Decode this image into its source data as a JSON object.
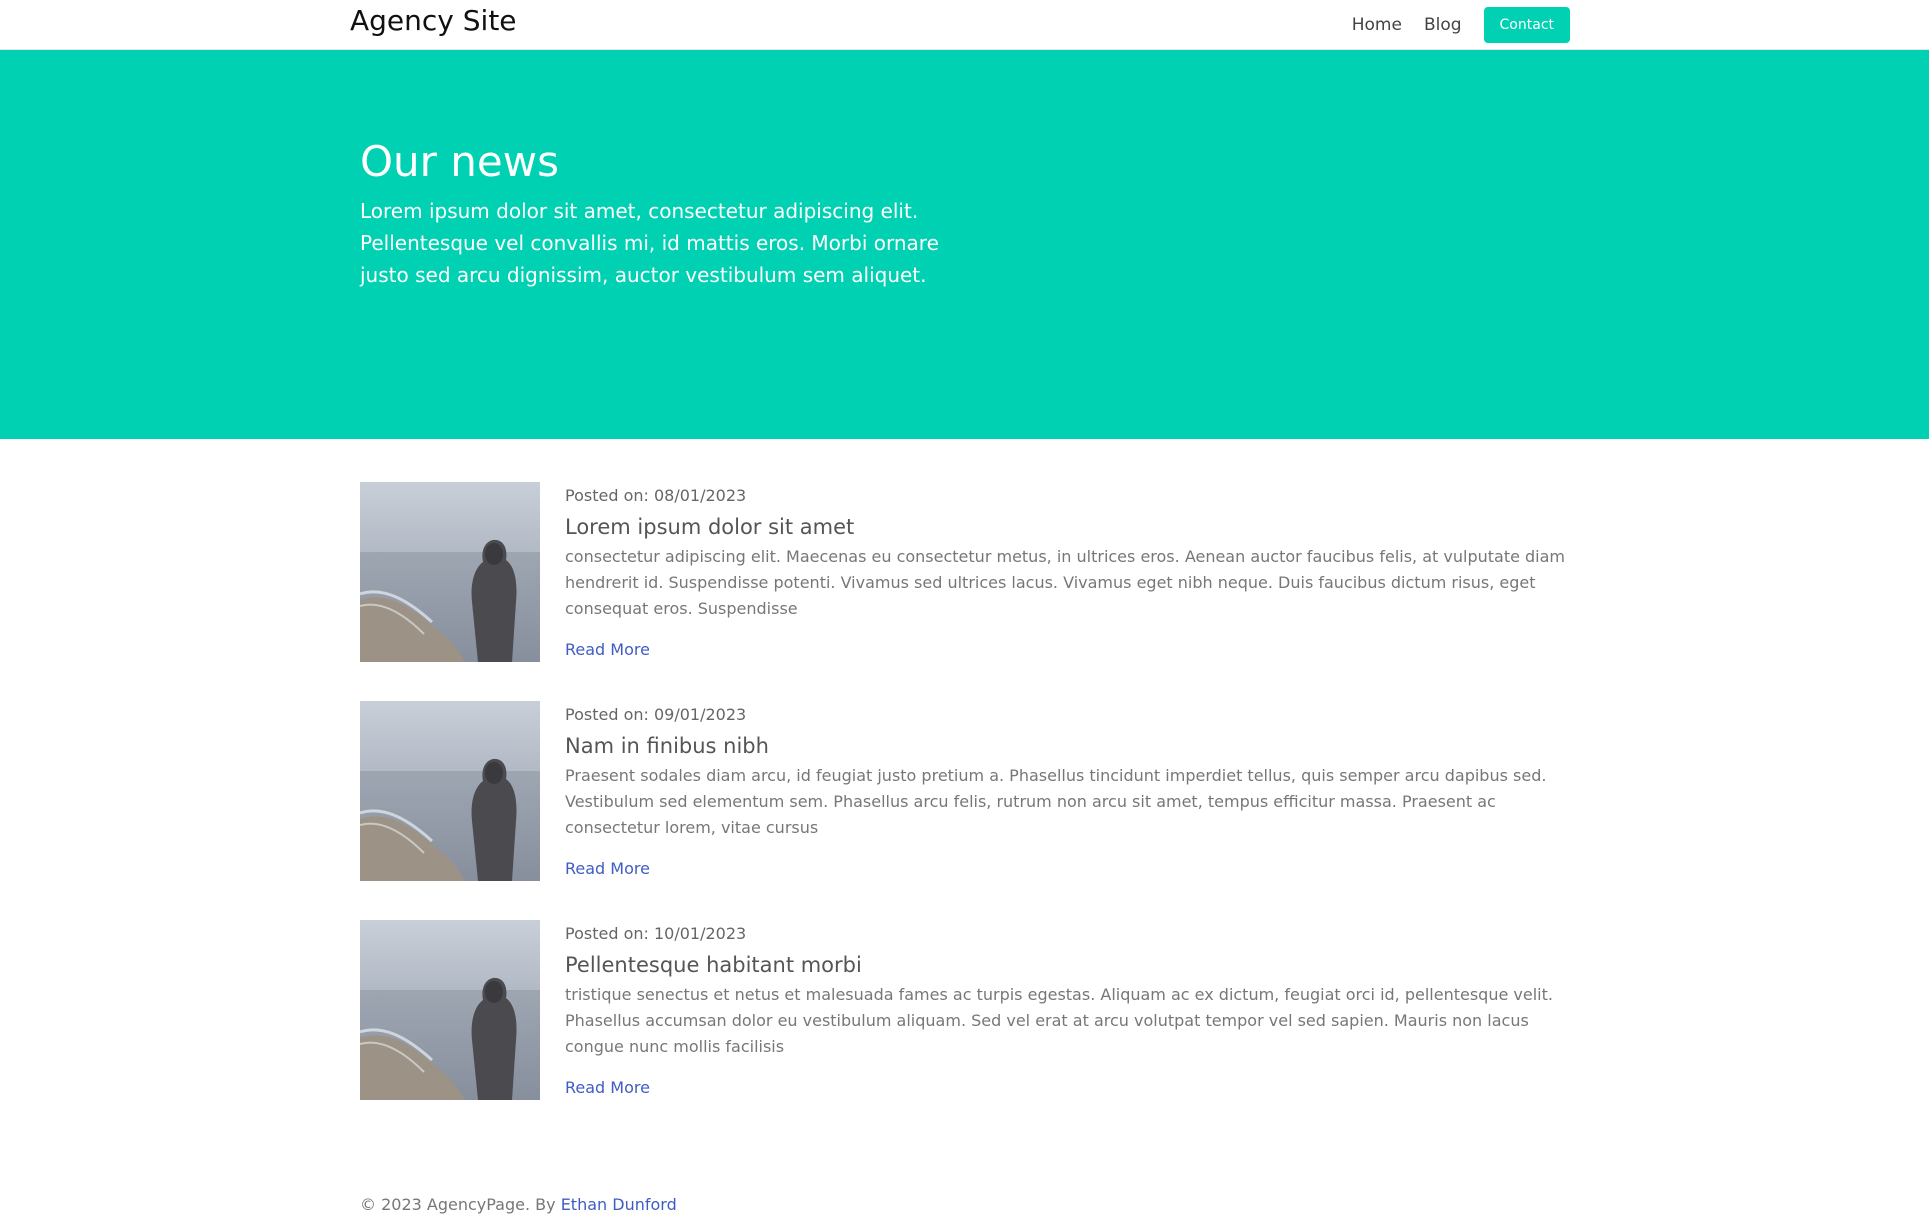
{
  "nav": {
    "brand": "Agency Site",
    "links": [
      {
        "label": "Home"
      },
      {
        "label": "Blog"
      }
    ],
    "contact_label": "Contact"
  },
  "hero": {
    "title": "Our news",
    "subtitle": "Lorem ipsum dolor sit amet, consectetur adipiscing elit. Pellentesque vel convallis mi, id mattis eros. Morbi ornare justo sed arcu dignissim, auctor vestibulum sem aliquet."
  },
  "posts": [
    {
      "date": "Posted on: 08/01/2023",
      "title": "Lorem ipsum dolor sit amet",
      "excerpt": "consectetur adipiscing elit. Maecenas eu consectetur metus, in ultrices eros. Aenean auctor faucibus felis, at vulputate diam hendrerit id. Suspendisse potenti. Vivamus sed ultrices lacus. Vivamus eget nibh neque. Duis faucibus dictum risus, eget consequat eros. Suspendisse",
      "link": "Read More"
    },
    {
      "date": "Posted on: 09/01/2023",
      "title": "Nam in finibus nibh",
      "excerpt": "Praesent sodales diam arcu, id feugiat justo pretium a. Phasellus tincidunt imperdiet tellus, quis semper arcu dapibus sed. Vestibulum sed elementum sem. Phasellus arcu felis, rutrum non arcu sit amet, tempus efficitur massa. Praesent ac consectetur lorem, vitae cursus",
      "link": "Read More"
    },
    {
      "date": "Posted on: 10/01/2023",
      "title": "Pellentesque habitant morbi",
      "excerpt": "tristique senectus et netus et malesuada fames ac turpis egestas. Aliquam ac ex dictum, feugiat orci id, pellentesque velit. Phasellus accumsan dolor eu vestibulum aliquam. Sed vel erat at arcu volutpat tempor vel sed sapien. Mauris non lacus congue nunc mollis facilisis",
      "link": "Read More"
    }
  ],
  "footer": {
    "text": "© 2023 AgencyPage. By ",
    "author": "Ethan Dunford"
  },
  "colors": {
    "accent": "#00d1b2",
    "link": "#3f5cc4"
  }
}
